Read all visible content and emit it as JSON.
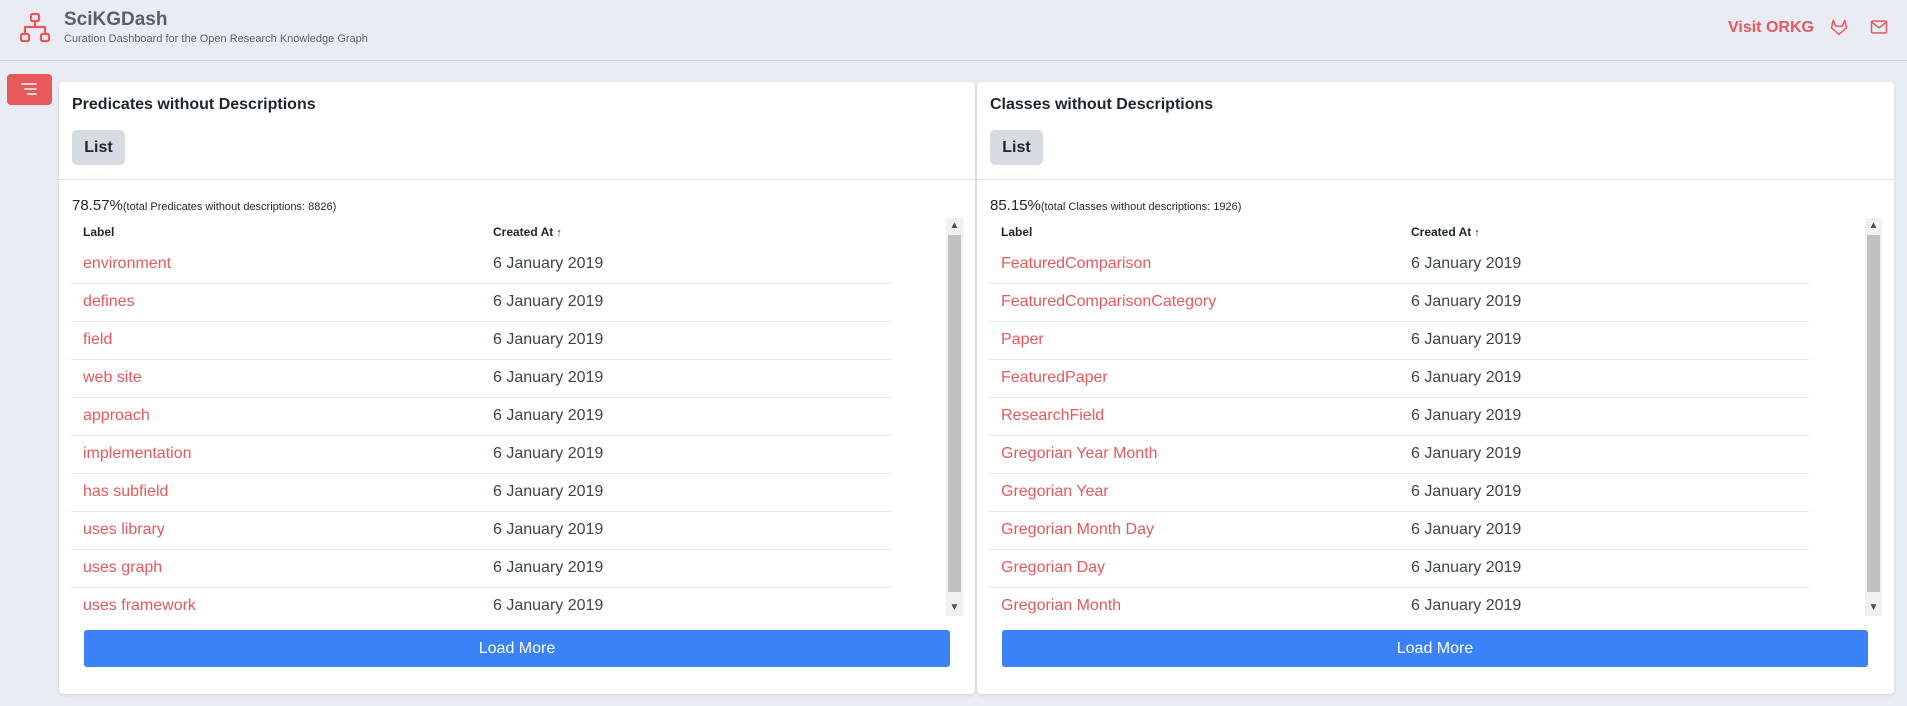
{
  "header": {
    "title": "SciKGDash",
    "subtitle": "Curation Dashboard for the Open Research Knowledge Graph",
    "visit_link": "Visit ORKG",
    "accent_color": "#e8595c"
  },
  "icons": {
    "logo": "sitemap-icon",
    "gitlab": "gitlab-icon",
    "mail": "mail-icon",
    "menu": "menu-lines-icon"
  },
  "panels": [
    {
      "title": "Predicates without Descriptions",
      "list_button": "List",
      "percent": "78.57%",
      "note": "(total Predicates without descriptions: 8826)",
      "columns": {
        "label": "Label",
        "created": "Created At"
      },
      "sort_arrow": "↑",
      "rows": [
        {
          "label": "environment",
          "date": "6 January 2019"
        },
        {
          "label": "defines",
          "date": "6 January 2019"
        },
        {
          "label": "field",
          "date": "6 January 2019"
        },
        {
          "label": "web site",
          "date": "6 January 2019"
        },
        {
          "label": "approach",
          "date": "6 January 2019"
        },
        {
          "label": "implementation",
          "date": "6 January 2019"
        },
        {
          "label": "has subfield",
          "date": "6 January 2019"
        },
        {
          "label": "uses library",
          "date": "6 January 2019"
        },
        {
          "label": "uses graph",
          "date": "6 January 2019"
        },
        {
          "label": "uses framework",
          "date": "6 January 2019"
        }
      ],
      "load_more": "Load More"
    },
    {
      "title": "Classes without Descriptions",
      "list_button": "List",
      "percent": "85.15%",
      "note": "(total Classes without descriptions: 1926)",
      "columns": {
        "label": "Label",
        "created": "Created At"
      },
      "sort_arrow": "↑",
      "rows": [
        {
          "label": "FeaturedComparison",
          "date": "6 January 2019"
        },
        {
          "label": "FeaturedComparisonCategory",
          "date": "6 January 2019"
        },
        {
          "label": "Paper",
          "date": "6 January 2019"
        },
        {
          "label": "FeaturedPaper",
          "date": "6 January 2019"
        },
        {
          "label": "ResearchField",
          "date": "6 January 2019"
        },
        {
          "label": "Gregorian Year Month",
          "date": "6 January 2019"
        },
        {
          "label": "Gregorian Year",
          "date": "6 January 2019"
        },
        {
          "label": "Gregorian Month Day",
          "date": "6 January 2019"
        },
        {
          "label": "Gregorian Day",
          "date": "6 January 2019"
        },
        {
          "label": "Gregorian Month",
          "date": "6 January 2019"
        }
      ],
      "load_more": "Load More"
    }
  ]
}
